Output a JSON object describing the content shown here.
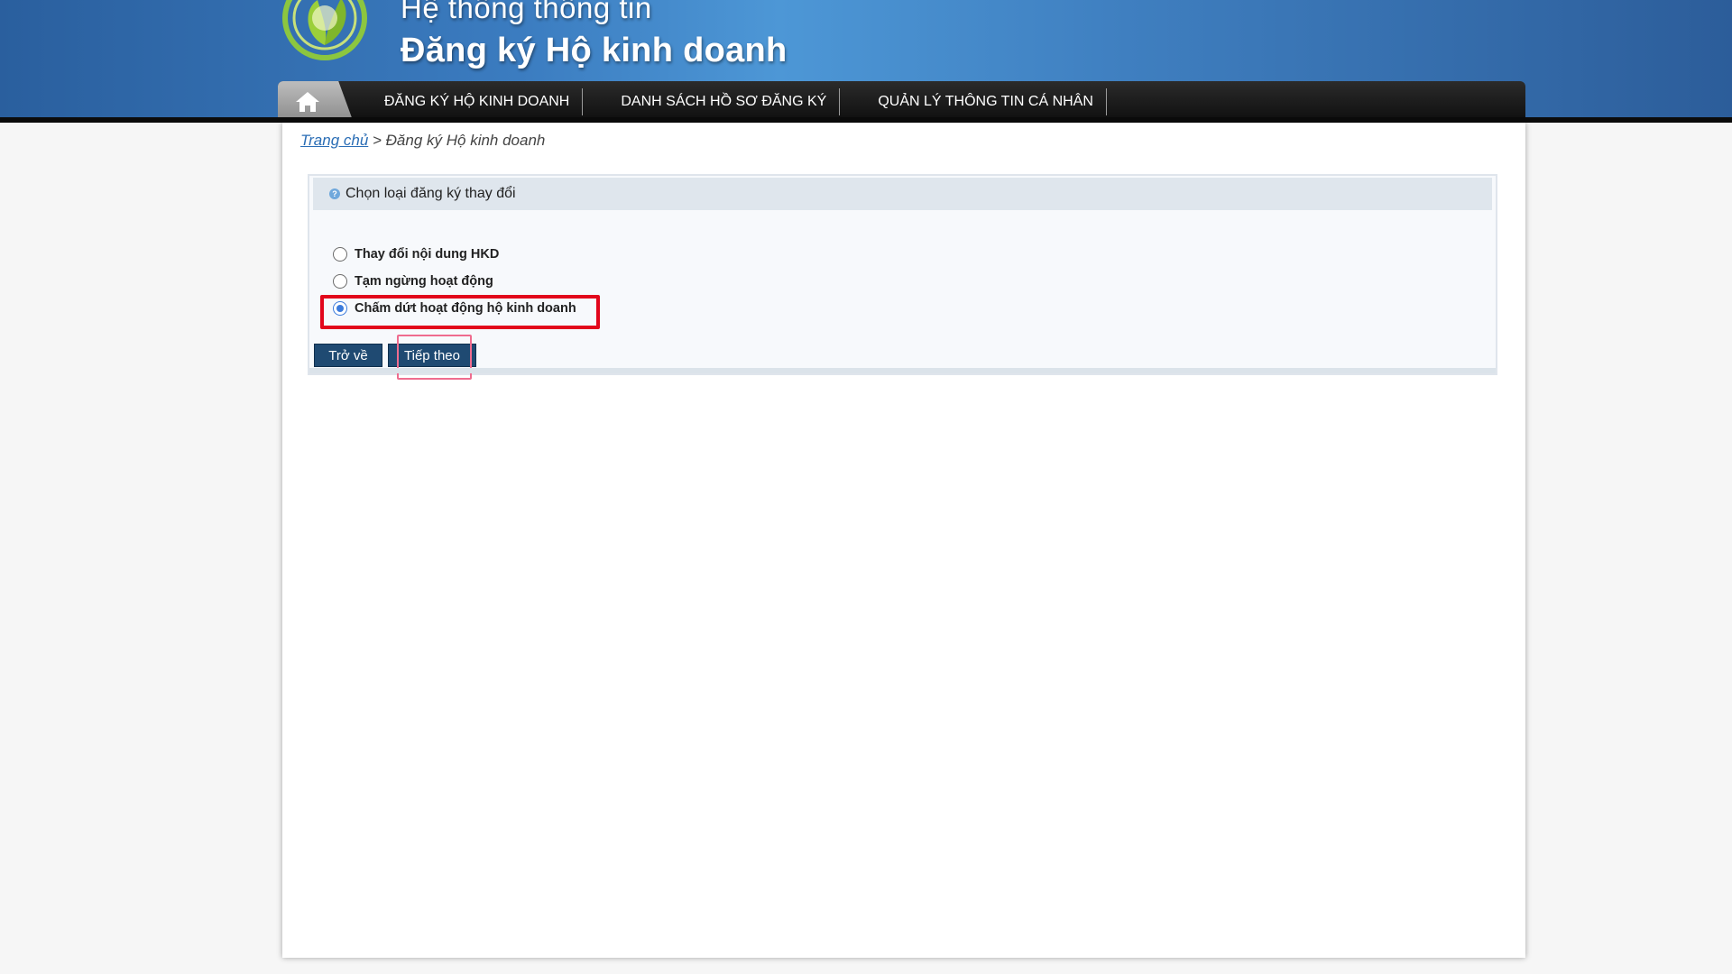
{
  "header": {
    "title_line1": "Hệ thống thông tin",
    "title_line2": "Đăng ký Hộ kinh doanh",
    "logo_icon": "leaf-logo-icon"
  },
  "nav": {
    "home_icon": "home-icon",
    "items": [
      {
        "label": "ĐĂNG KÝ HỘ KINH DOANH"
      },
      {
        "label": "DANH SÁCH HỒ SƠ ĐĂNG KÝ"
      },
      {
        "label": "QUẢN LÝ THÔNG TIN CÁ NHÂN"
      }
    ]
  },
  "breadcrumb": {
    "home": "Trang chủ",
    "separator": " > ",
    "current": "Đăng ký Hộ kinh doanh"
  },
  "panel": {
    "title": "Chọn loại đăng ký thay đổi",
    "help_icon_glyph": "?",
    "options": [
      {
        "label": "Thay đổi nội dung HKD",
        "checked": false
      },
      {
        "label": "Tạm ngừng hoạt động",
        "checked": false
      },
      {
        "label": "Chấm dứt hoạt động hộ kinh doanh",
        "checked": true
      }
    ],
    "back_label": "Trở về",
    "next_label": "Tiếp theo"
  },
  "colors": {
    "highlight_red": "#e2061b",
    "highlight_pink": "#ef6c8f",
    "button_bg": "#1f4a72",
    "radio_checked": "#3b7bdc"
  }
}
